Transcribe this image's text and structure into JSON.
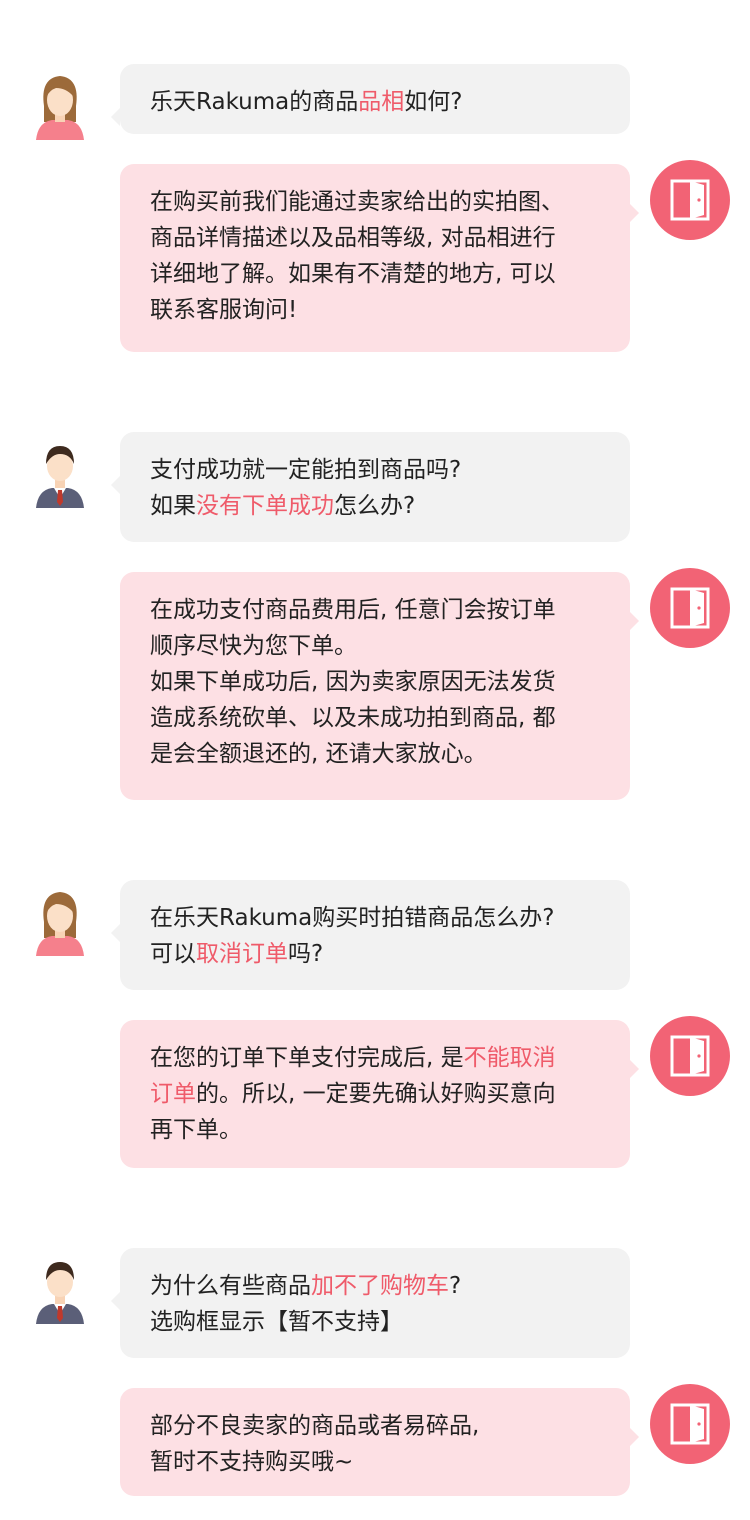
{
  "colors": {
    "accent": "#ef5b6a",
    "question_bg": "#f2f2f2",
    "answer_bg": "#fde0e4",
    "door_circle": "#f26375"
  },
  "icons": {
    "female_user": "female-avatar-icon",
    "male_user": "male-avatar-icon",
    "service": "door-icon"
  },
  "qa1": {
    "q": {
      "pre": "乐天Rakuma的商品",
      "hl": "品相",
      "post": "如何?"
    },
    "a": [
      "在购买前我们能通过卖家给出的实拍图、",
      "商品详情描述以及品相等级, 对品相进行",
      "详细地了解。如果有不清楚的地方, 可以",
      "联系客服询问!"
    ]
  },
  "qa2": {
    "q1": "支付成功就一定能拍到商品吗?",
    "q2": {
      "pre": "如果",
      "hl": "没有下单成功",
      "post": "怎么办?"
    },
    "a": [
      "在成功支付商品费用后, 任意门会按订单",
      "顺序尽快为您下单。",
      "如果下单成功后, 因为卖家原因无法发货",
      "造成系统砍单、以及未成功拍到商品, 都",
      "是会全额退还的, 还请大家放心。"
    ]
  },
  "qa3": {
    "q1": "在乐天Rakuma购买时拍错商品怎么办?",
    "q2": {
      "pre": "可以",
      "hl": "取消订单",
      "post": "吗?"
    },
    "a1": {
      "pre": "在您的订单下单支付完成后, 是",
      "hl": "不能取消"
    },
    "a2": {
      "hl": "订单",
      "post": "的。所以, 一定要先确认好购买意向"
    },
    "a3": "再下单。"
  },
  "qa4": {
    "q1": {
      "pre": "为什么有些商品",
      "hl": "加不了购物车",
      "post": "?"
    },
    "q2": "选购框显示【暂不支持】",
    "a": [
      "部分不良卖家的商品或者易碎品,",
      "暂时不支持购买哦~"
    ]
  }
}
